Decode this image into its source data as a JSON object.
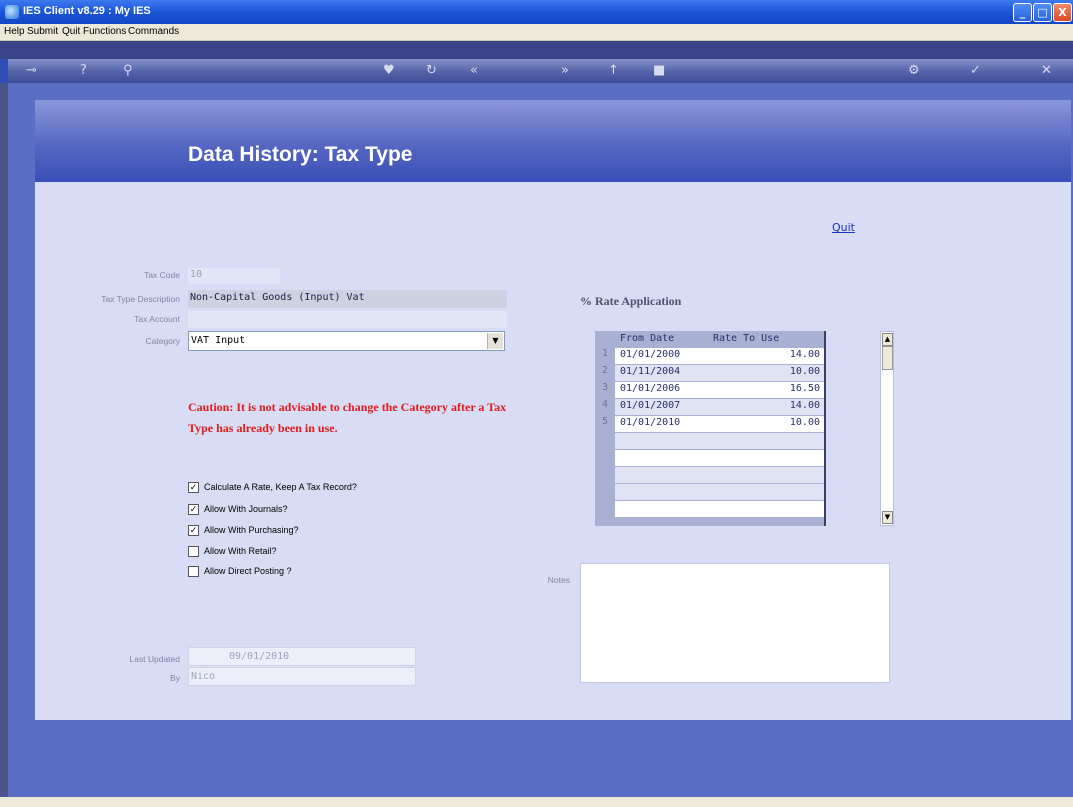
{
  "window": {
    "title": "IES Client v8.29 : My IES",
    "min": "_",
    "max": "□",
    "close": "X"
  },
  "menu": [
    "Help",
    "Submit",
    "Quit",
    "Functions",
    "Commands"
  ],
  "toolbar_icons": [
    "key-icon",
    "help-icon",
    "search-icon",
    "heart-icon",
    "refresh-icon",
    "rewind-icon",
    "forward-icon",
    "up-icon",
    "stop-icon",
    "gear-icon",
    "check-icon",
    "close-icon"
  ],
  "page": {
    "title": "Data History: Tax Type",
    "quit": "Quit"
  },
  "form": {
    "tax_code_label": "Tax Code",
    "tax_code_value": "10",
    "desc_label": "Tax Type Description",
    "desc_value": "Non-Capital Goods (Input) Vat",
    "account_label": "Tax Account",
    "account_value": "",
    "category_label": "Category",
    "category_value": "VAT Input",
    "caution": "Caution: It is not advisable to change the Category after a Tax Type has already been in use.",
    "checkboxes": [
      {
        "label": "Calculate A Rate, Keep A Tax Record?",
        "checked": true
      },
      {
        "label": "Allow With Journals?",
        "checked": true
      },
      {
        "label": "Allow With Purchasing?",
        "checked": true
      },
      {
        "label": "Allow With Retail?",
        "checked": false
      },
      {
        "label": "Allow Direct Posting ?",
        "checked": false
      }
    ],
    "last_updated_label": "Last Updated",
    "last_updated_value": "09/01/2010",
    "by_label": "By",
    "by_value": "Nico"
  },
  "rates": {
    "title": "% Rate Application",
    "col_from": "From Date",
    "col_rate": "Rate To Use",
    "rows": [
      {
        "idx": "1",
        "date": "01/01/2000",
        "rate": "14.00"
      },
      {
        "idx": "2",
        "date": "01/11/2004",
        "rate": "10.00"
      },
      {
        "idx": "3",
        "date": "01/01/2006",
        "rate": "16.50"
      },
      {
        "idx": "4",
        "date": "01/01/2007",
        "rate": "14.00"
      },
      {
        "idx": "5",
        "date": "01/01/2010",
        "rate": "10.00"
      }
    ]
  },
  "notes": {
    "label": "Notes",
    "value": ""
  },
  "colors": {
    "caution": "#e01b1b",
    "link": "#1c33c4",
    "header": "#5667c2"
  }
}
